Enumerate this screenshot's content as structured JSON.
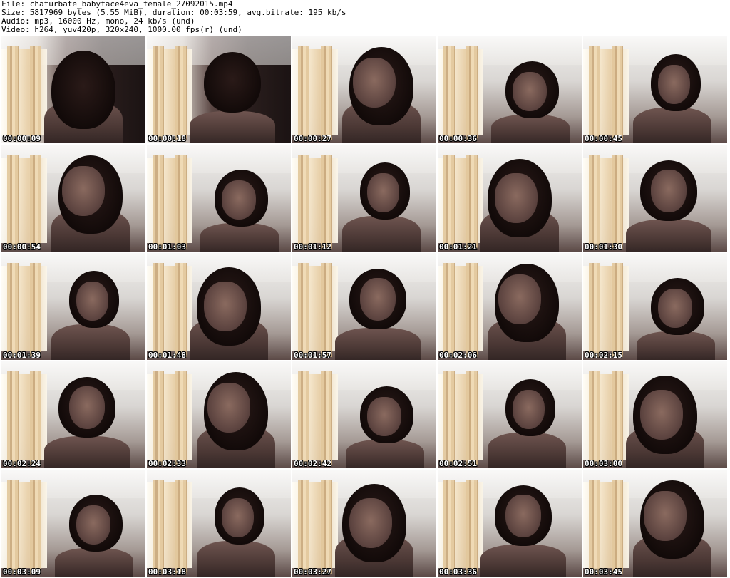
{
  "header": {
    "file_line": "File: chaturbate_babyface4eva_female_27092015.mp4",
    "size_line": "Size: 5817969 bytes (5.55 MiB), duration: 00:03:59, avg.bitrate: 195 kb/s",
    "audio_line": "Audio: mp3, 16000 Hz, mono, 24 kb/s (und)",
    "video_line": "Video: h264, yuv420p, 320x240, 1000.00 fps(r) (und)"
  },
  "thumbnails": [
    {
      "timestamp": "00:00:09"
    },
    {
      "timestamp": "00:00:18"
    },
    {
      "timestamp": "00:00:27"
    },
    {
      "timestamp": "00:00:36"
    },
    {
      "timestamp": "00:00:45"
    },
    {
      "timestamp": "00:00:54"
    },
    {
      "timestamp": "00:01:03"
    },
    {
      "timestamp": "00:01:12"
    },
    {
      "timestamp": "00:01:21"
    },
    {
      "timestamp": "00:01:30"
    },
    {
      "timestamp": "00:01:39"
    },
    {
      "timestamp": "00:01:48"
    },
    {
      "timestamp": "00:01:57"
    },
    {
      "timestamp": "00:02:06"
    },
    {
      "timestamp": "00:02:15"
    },
    {
      "timestamp": "00:02:24"
    },
    {
      "timestamp": "00:02:33"
    },
    {
      "timestamp": "00:02:42"
    },
    {
      "timestamp": "00:02:51"
    },
    {
      "timestamp": "00:03:00"
    },
    {
      "timestamp": "00:03:09"
    },
    {
      "timestamp": "00:03:18"
    },
    {
      "timestamp": "00:03:27"
    },
    {
      "timestamp": "00:03:36"
    },
    {
      "timestamp": "00:03:45"
    }
  ]
}
